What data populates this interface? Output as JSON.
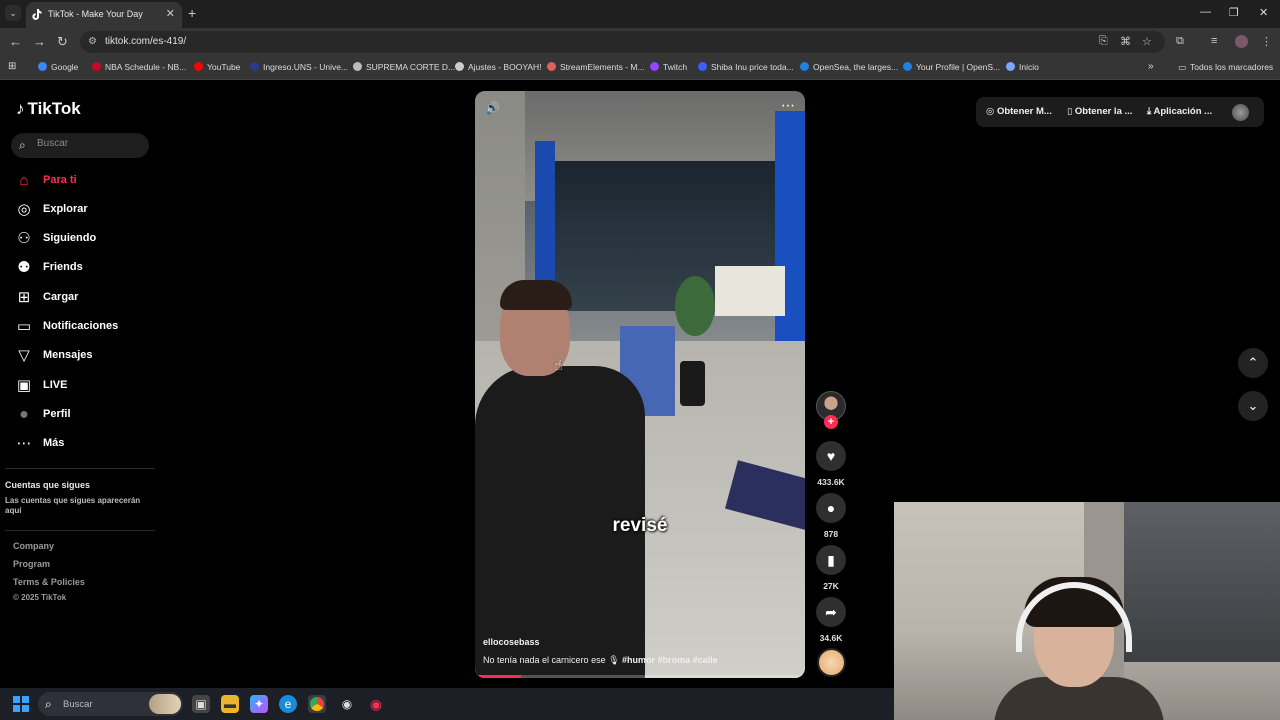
{
  "browser": {
    "tab_title": "TikTok - Make Your Day",
    "url": "tiktok.com/es-419/",
    "bookmarks": [
      {
        "label": "Google",
        "color": "#4285f4"
      },
      {
        "label": "NBA Schedule - NB...",
        "color": "#c9082a"
      },
      {
        "label": "YouTube",
        "color": "#ff0000"
      },
      {
        "label": "Ingreso.UNS - Unive...",
        "color": "#2b3a8a"
      },
      {
        "label": "SUPREMA CORTE D...",
        "color": "#bbbbbb"
      },
      {
        "label": "Ajustes - BOOYAH!",
        "color": "#cccccc"
      },
      {
        "label": "StreamElements - M...",
        "color": "#e06060"
      },
      {
        "label": "Twitch",
        "color": "#9146ff"
      },
      {
        "label": "Shiba Inu price toda...",
        "color": "#3861fb"
      },
      {
        "label": "OpenSea, the larges...",
        "color": "#2081e2"
      },
      {
        "label": "Your Profile | OpenS...",
        "color": "#2081e2"
      },
      {
        "label": "Inicio",
        "color": "#7aa7ff"
      }
    ],
    "all_bookmarks": "Todos los marcadores"
  },
  "tiktok": {
    "logo": "TikTok",
    "search_placeholder": "Buscar",
    "nav": [
      {
        "label": "Para ti",
        "icon": "home-icon",
        "glyph": "⌂"
      },
      {
        "label": "Explorar",
        "icon": "compass-icon",
        "glyph": "◎"
      },
      {
        "label": "Siguiendo",
        "icon": "following-icon",
        "glyph": "⚇"
      },
      {
        "label": "Friends",
        "icon": "friends-icon",
        "glyph": "⚉"
      },
      {
        "label": "Cargar",
        "icon": "upload-icon",
        "glyph": "⊞"
      },
      {
        "label": "Notificaciones",
        "icon": "notifications-icon",
        "glyph": "▭"
      },
      {
        "label": "Mensajes",
        "icon": "messages-icon",
        "glyph": "▽"
      },
      {
        "label": "LIVE",
        "icon": "live-icon",
        "glyph": "▣"
      },
      {
        "label": "Perfil",
        "icon": "profile-icon",
        "glyph": "●"
      },
      {
        "label": "Más",
        "icon": "more-icon",
        "glyph": "⋯"
      }
    ],
    "following_heading": "Cuentas que sigues",
    "following_text": "Las cuentas que sigues aparecerán aquí",
    "footer": [
      "Company",
      "Program",
      "Terms & Policies",
      "© 2025 TikTok"
    ],
    "top_buttons": [
      "Obtener M...",
      "Obtener la ...",
      "Aplicación ..."
    ],
    "video": {
      "caption": "revisé",
      "author": "ellocosebass",
      "description": "No tenía nada el carnicero ese 🎙",
      "hashtags": [
        "#humor",
        "#broma",
        "#calle"
      ],
      "progress": 0.14
    },
    "actions": {
      "likes": "433.6K",
      "comments": "878",
      "saves": "27K",
      "shares": "34.6K"
    },
    "accent_color": "#fe2c55"
  },
  "taskbar": {
    "search_label": "Buscar"
  }
}
